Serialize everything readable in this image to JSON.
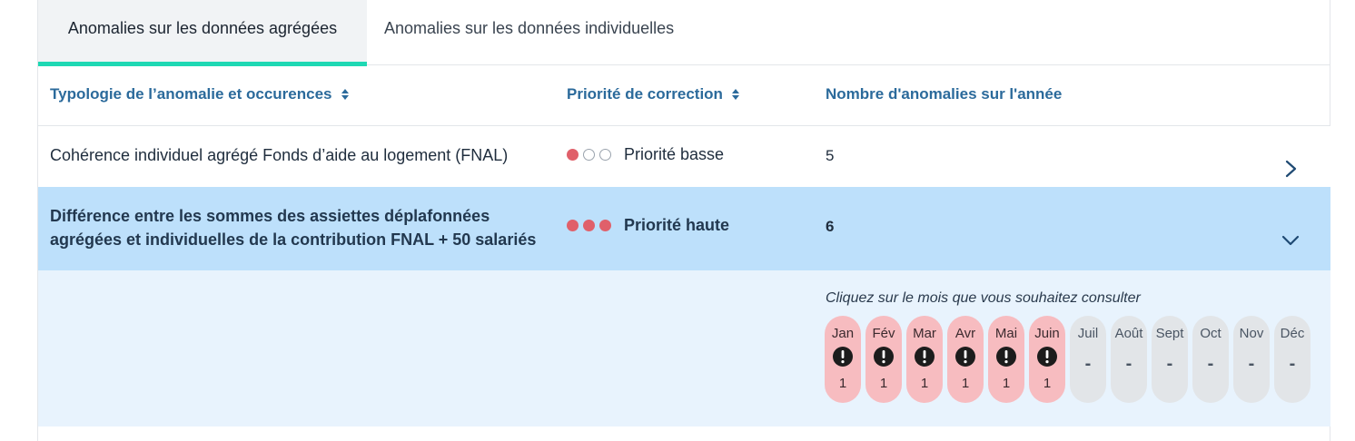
{
  "tabs": [
    {
      "label": "Anomalies sur les données agrégées",
      "active": true
    },
    {
      "label": "Anomalies sur les données individuelles",
      "active": false
    }
  ],
  "table": {
    "headers": {
      "typology": "Typologie de l’anomalie et occurences",
      "priority": "Priorité de correction",
      "count": "Nombre d'anomalies sur l'année"
    },
    "rows": [
      {
        "label": "Cohérence individuel agrégé Fonds d’aide au logement (FNAL)",
        "priority_level": 1,
        "priority_label": "Priorité basse",
        "count": "5",
        "expanded": false
      },
      {
        "label": "Différence entre les sommes des assiettes déplafonnées agrégées et individuelles de la contribution FNAL + 50 salariés",
        "priority_level": 3,
        "priority_label": "Priorité haute",
        "count": "6",
        "expanded": true
      }
    ]
  },
  "detail": {
    "hint": "Cliquez sur le mois que vous souhaitez consulter",
    "months": [
      {
        "label": "Jan",
        "value": "1",
        "alert": true
      },
      {
        "label": "Fév",
        "value": "1",
        "alert": true
      },
      {
        "label": "Mar",
        "value": "1",
        "alert": true
      },
      {
        "label": "Avr",
        "value": "1",
        "alert": true
      },
      {
        "label": "Mai",
        "value": "1",
        "alert": true
      },
      {
        "label": "Juin",
        "value": "1",
        "alert": true
      },
      {
        "label": "Juil",
        "value": "-",
        "alert": false
      },
      {
        "label": "Août",
        "value": "-",
        "alert": false
      },
      {
        "label": "Sept",
        "value": "-",
        "alert": false
      },
      {
        "label": "Oct",
        "value": "-",
        "alert": false
      },
      {
        "label": "Nov",
        "value": "-",
        "alert": false
      },
      {
        "label": "Déc",
        "value": "-",
        "alert": false
      }
    ]
  },
  "colors": {
    "accent_tab": "#1ed8b3",
    "header_text": "#2b6a9b",
    "selected_row": "#bde0fb",
    "detail_bg": "#e8f3fd",
    "priority_dot": "#e0606a",
    "month_alert": "#f7bcc0",
    "month_empty": "#e2e5e8"
  },
  "icons": {
    "sort": "sort-icon",
    "collapsed": "chevron-right-icon",
    "expanded": "chevron-down-icon",
    "alert": "exclamation-circle-icon"
  }
}
